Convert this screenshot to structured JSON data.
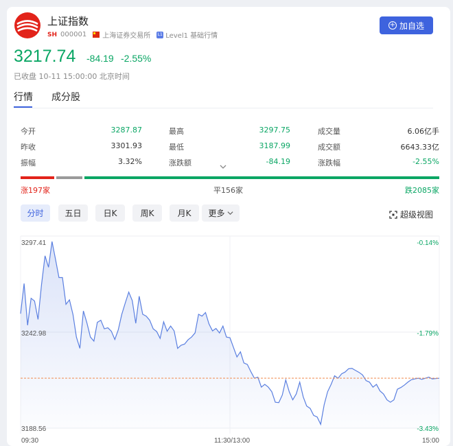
{
  "header": {
    "name": "上证指数",
    "market": "SH",
    "code": "000001",
    "exchange": "上海证券交易所",
    "level_badge": "L1",
    "level": "Level1 基础行情",
    "add_button": "加自选"
  },
  "quote": {
    "price": "3217.74",
    "change": "-84.19",
    "change_pct": "-2.55%",
    "status": "已收盘 10-11 15:00:00 北京时间"
  },
  "tabs": [
    "行情",
    "成分股"
  ],
  "stats": {
    "col1": [
      {
        "label": "今开",
        "value": "3287.87"
      },
      {
        "label": "昨收",
        "value": "3301.93"
      },
      {
        "label": "振幅",
        "value": "3.32%"
      }
    ],
    "col2": [
      {
        "label": "最高",
        "value": "3297.75"
      },
      {
        "label": "最低",
        "value": "3187.99"
      },
      {
        "label": "涨跌额",
        "value": "-84.19"
      }
    ],
    "col3": [
      {
        "label": "成交量",
        "value": "6.06亿手"
      },
      {
        "label": "成交额",
        "value": "6643.33亿"
      },
      {
        "label": "涨跌幅",
        "value": "-2.55%"
      }
    ]
  },
  "breadth": {
    "up": "涨197家",
    "flat": "平156家",
    "down": "跌2085家",
    "up_count": 197,
    "flat_count": 156,
    "down_count": 2085
  },
  "period_buttons": [
    "分时",
    "五日",
    "日K",
    "周K",
    "月K",
    "更多"
  ],
  "super_view": "超级视图",
  "colors": {
    "green": "#0aa664",
    "red": "#e2231a",
    "accent": "#3e63de",
    "line": "#5a7fe0"
  },
  "chart_data": {
    "type": "area",
    "y_labels_left": [
      "3297.41",
      "3242.98",
      "3188.56"
    ],
    "y_labels_right": [
      "-0.14%",
      "-1.79%",
      "-3.43%"
    ],
    "x_labels": [
      "09:30",
      "11:30/13:00",
      "15:00"
    ],
    "ylim": [
      3188.56,
      3297.41
    ],
    "reference": 3217.74,
    "x": [
      0,
      2,
      4,
      6,
      8,
      10,
      12,
      14,
      16,
      18,
      20,
      22,
      24,
      26,
      28,
      30,
      32,
      34,
      36,
      38,
      40,
      42,
      44,
      46,
      48,
      50,
      52,
      54,
      56,
      58,
      60,
      62,
      64,
      66,
      68,
      70,
      72,
      74,
      76,
      78,
      80,
      82,
      84,
      86,
      88,
      90,
      92,
      94,
      96,
      98,
      100,
      102,
      104,
      106,
      108,
      110,
      112,
      114,
      116,
      118,
      120,
      122,
      124,
      126,
      128,
      130,
      132,
      134,
      136,
      138,
      140,
      142,
      144,
      146,
      148,
      150,
      152,
      154,
      156,
      158,
      160,
      162,
      164,
      166,
      168,
      170,
      172,
      174,
      176,
      178,
      180,
      182,
      184,
      186,
      188,
      190,
      192,
      194,
      196,
      198,
      200,
      202,
      204,
      206,
      208,
      210,
      212,
      214,
      216,
      218,
      220,
      222,
      224,
      226,
      228,
      230,
      232,
      234,
      236,
      238,
      240
    ],
    "values": [
      3255.3,
      3272.9,
      3248.6,
      3264.3,
      3262.7,
      3252.0,
      3272.3,
      3289.1,
      3282.4,
      3297.4,
      3287.2,
      3276.4,
      3276.4,
      3260.8,
      3263.4,
      3254.9,
      3241.7,
      3235.1,
      3256.9,
      3250.0,
      3241.7,
      3239.3,
      3250.3,
      3251.5,
      3246.5,
      3247.1,
      3245.1,
      3240.3,
      3245.9,
      3254.9,
      3261.6,
      3267.9,
      3263.0,
      3249.7,
      3265.5,
      3255.0,
      3253.9,
      3251.5,
      3246.5,
      3244.9,
      3240.9,
      3250.6,
      3245.1,
      3248.1,
      3245.3,
      3235.1,
      3236.9,
      3237.6,
      3240.1,
      3241.7,
      3244.1,
      3255.0,
      3253.9,
      3256.0,
      3249.3,
      3245.3,
      3246.7,
      3244.1,
      3248.1,
      3241.7,
      3241.3,
      3235.7,
      3230.1,
      3233.1,
      3226.6,
      3225.7,
      3221.5,
      3217.7,
      3218.3,
      3212.5,
      3214.1,
      3212.5,
      3209.8,
      3203.7,
      3203.5,
      3207.9,
      3216.7,
      3209.8,
      3205.1,
      3208.5,
      3215.4,
      3206.8,
      3201.5,
      3200.1,
      3196.0,
      3195.1,
      3190.8,
      3202.2,
      3209.8,
      3214.1,
      3219.1,
      3217.7,
      3220.2,
      3221.3,
      3223.2,
      3223.4,
      3222.2,
      3221.1,
      3219.6,
      3216.3,
      3215.4,
      3212.5,
      3214.1,
      3210.3,
      3208.5,
      3205.1,
      3203.7,
      3205.1,
      3211.3,
      3212.3,
      3213.7,
      3215.4,
      3216.8,
      3217.3,
      3217.7,
      3217.0,
      3217.7,
      3218.3,
      3217.3,
      3217.5,
      3217.7
    ]
  }
}
